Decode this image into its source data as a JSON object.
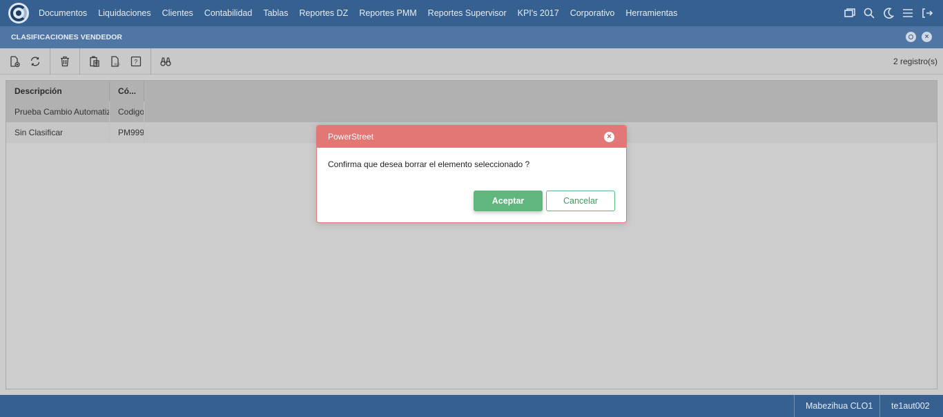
{
  "nav": {
    "logo": "app-logo",
    "items": [
      "Documentos",
      "Liquidaciones",
      "Clientes",
      "Contabilidad",
      "Tablas",
      "Reportes DZ",
      "Reportes PMM",
      "Reportes Supervisor",
      "KPI's 2017",
      "Corporativo",
      "Herramientas"
    ],
    "icons": [
      "windows-icon",
      "search-icon",
      "moon-icon",
      "menu-icon",
      "logout-icon"
    ]
  },
  "window": {
    "title": "CLASIFICACIONES VENDEDOR",
    "close_symbol": "×"
  },
  "toolbar": {
    "icons": [
      "new-document-icon",
      "refresh-icon",
      "delete-icon",
      "clipboard-icon",
      "export-xls-icon",
      "help-icon",
      "binoculars-icon"
    ],
    "xls_text": "XLS",
    "help_text": "?",
    "record_count": "2 registro(s)"
  },
  "grid": {
    "columns": [
      "Descripción",
      "Có..."
    ],
    "rows": [
      [
        "Prueba Cambio Automatiz",
        "Codigo"
      ],
      [
        "Sin Clasificar",
        "PM999"
      ]
    ]
  },
  "dialog": {
    "title": "PowerStreet",
    "close_symbol": "×",
    "message": "Confirma que desea borrar el elemento seleccionado ?",
    "accept_label": "Aceptar",
    "cancel_label": "Cancelar",
    "colors": {
      "header": "#e37776",
      "accept": "#5fb77e"
    }
  },
  "status": {
    "user": "Mabezihua CLO1",
    "code": "te1aut002"
  }
}
